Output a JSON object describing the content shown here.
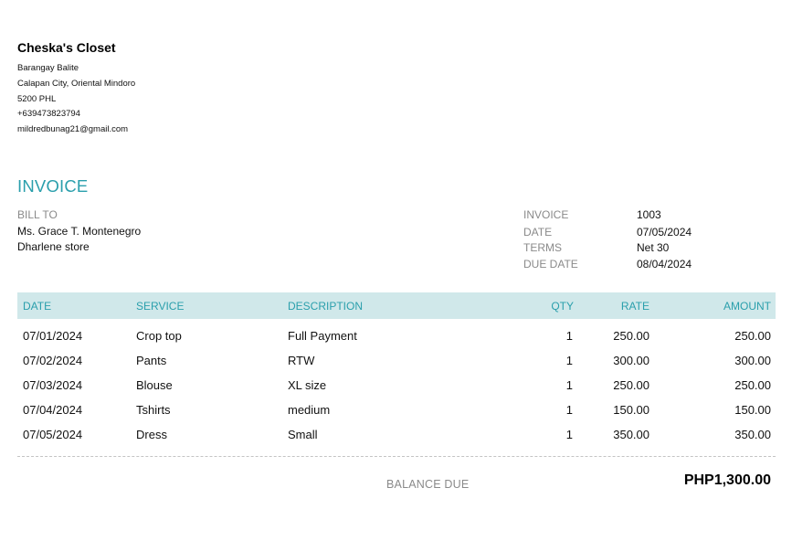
{
  "company": {
    "name": "Cheska's Closet",
    "address_line1": "Barangay Balite",
    "address_line2": "Calapan City, Oriental Mindoro",
    "address_line3": "5200 PHL",
    "phone": "+639473823794",
    "email": "mildredbunag21@gmail.com"
  },
  "invoice_title": "INVOICE",
  "bill_to": {
    "label": "BILL TO",
    "name": "Ms. Grace T. Montenegro",
    "store": "Dharlene store"
  },
  "meta": {
    "invoice_label": "INVOICE",
    "invoice_value": "1003",
    "date_label": "DATE",
    "date_value": "07/05/2024",
    "terms_label": "TERMS",
    "terms_value": "Net 30",
    "due_label": "DUE DATE",
    "due_value": "08/04/2024"
  },
  "table": {
    "headers": {
      "date": "DATE",
      "service": "SERVICE",
      "description": "DESCRIPTION",
      "qty": "QTY",
      "rate": "RATE",
      "amount": "AMOUNT"
    },
    "rows": [
      {
        "date": "07/01/2024",
        "service": "Crop top",
        "description": "Full Payment",
        "qty": "1",
        "rate": "250.00",
        "amount": "250.00"
      },
      {
        "date": "07/02/2024",
        "service": "Pants",
        "description": "RTW",
        "qty": "1",
        "rate": "300.00",
        "amount": "300.00"
      },
      {
        "date": "07/03/2024",
        "service": "Blouse",
        "description": "XL size",
        "qty": "1",
        "rate": "250.00",
        "amount": "250.00"
      },
      {
        "date": "07/04/2024",
        "service": "Tshirts",
        "description": "medium",
        "qty": "1",
        "rate": "150.00",
        "amount": "150.00"
      },
      {
        "date": "07/05/2024",
        "service": "Dress",
        "description": "Small",
        "qty": "1",
        "rate": "350.00",
        "amount": "350.00"
      }
    ]
  },
  "balance": {
    "label": "BALANCE DUE",
    "value": "PHP1,300.00"
  },
  "colors": {
    "accent": "#2a9fac",
    "header_bg": "#d0e8ea",
    "muted": "#8a8a8a"
  }
}
